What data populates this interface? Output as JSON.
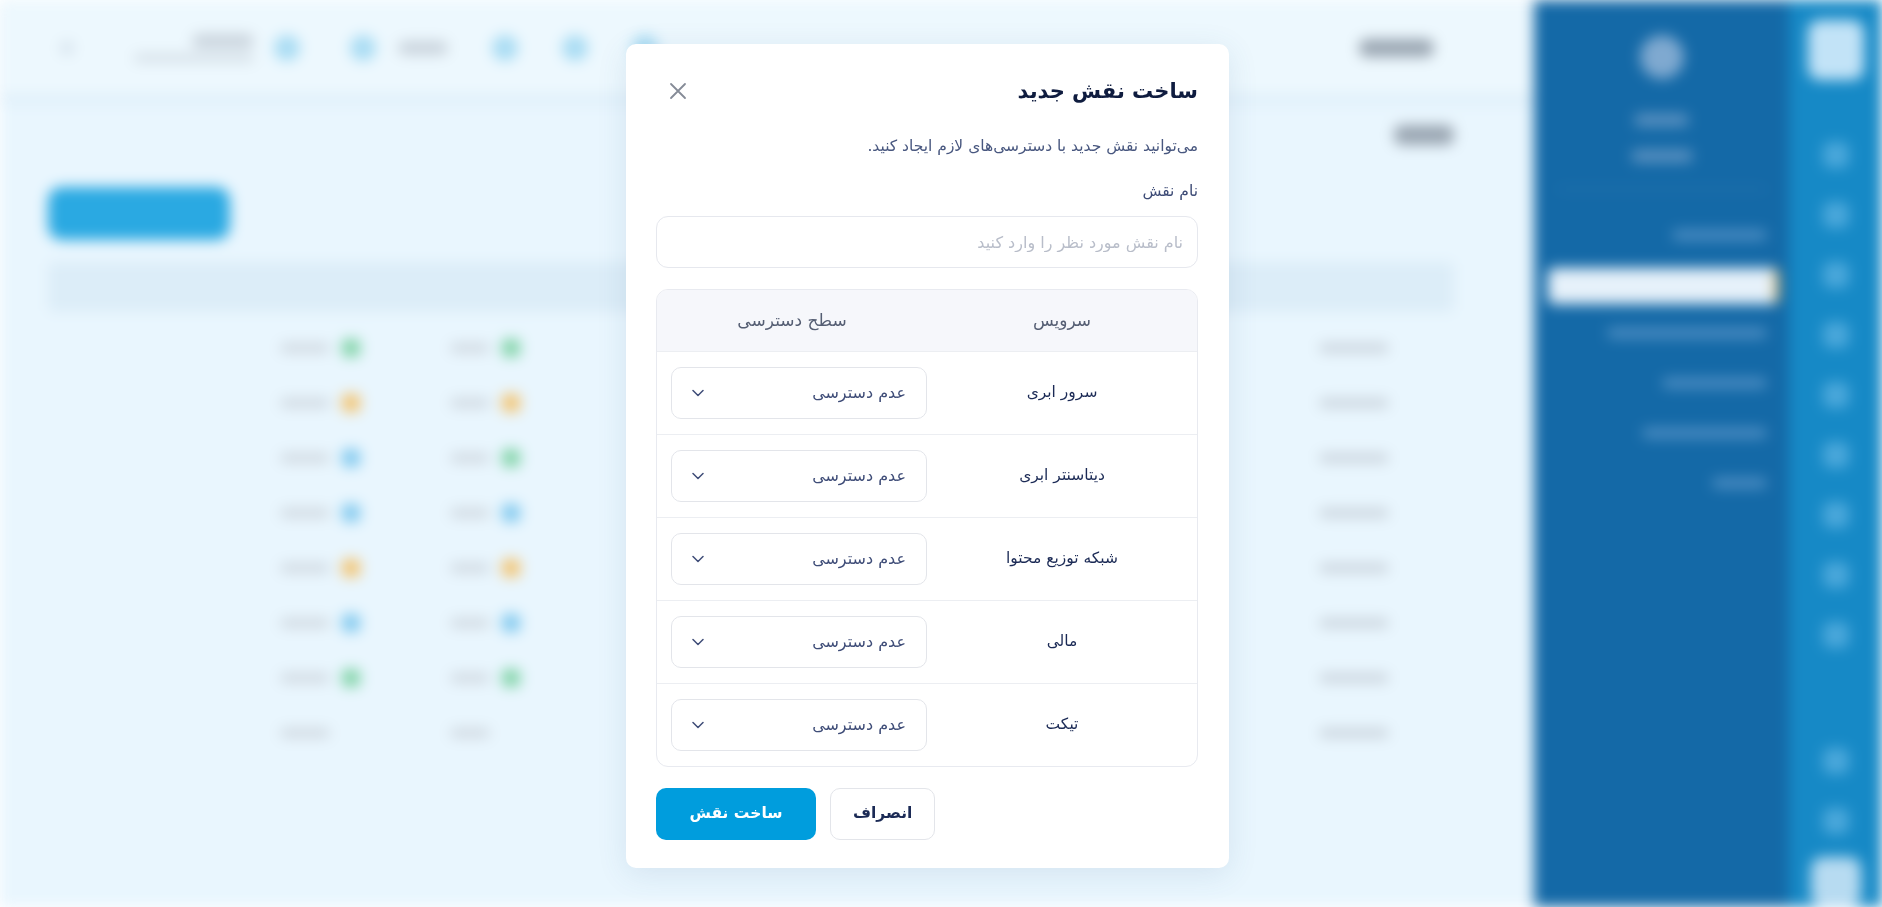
{
  "dialog": {
    "title": "ساخت نقش جدید",
    "description": "می‌توانید نقش جدید با دسترسی‌های لازم ایجاد کنید.",
    "name_field": {
      "label": "نام نقش",
      "placeholder": "نام نقش مورد نظر را وارد کنید"
    },
    "table": {
      "columns": [
        "سرویس",
        "سطح دسترسی"
      ],
      "rows": [
        {
          "service": "سرور ابری",
          "access": "عدم دسترسی"
        },
        {
          "service": "دیتاسنتر ابری",
          "access": "عدم دسترسی"
        },
        {
          "service": "شبکه توزیع محتوا",
          "access": "عدم دسترسی"
        },
        {
          "service": "مالی",
          "access": "عدم دسترسی"
        },
        {
          "service": "تیکت",
          "access": "عدم دسترسی"
        }
      ]
    },
    "buttons": [
      {
        "label": "انصراف",
        "kind": "secondary"
      },
      {
        "label": "ساخت نقش",
        "kind": "primary"
      }
    ]
  }
}
